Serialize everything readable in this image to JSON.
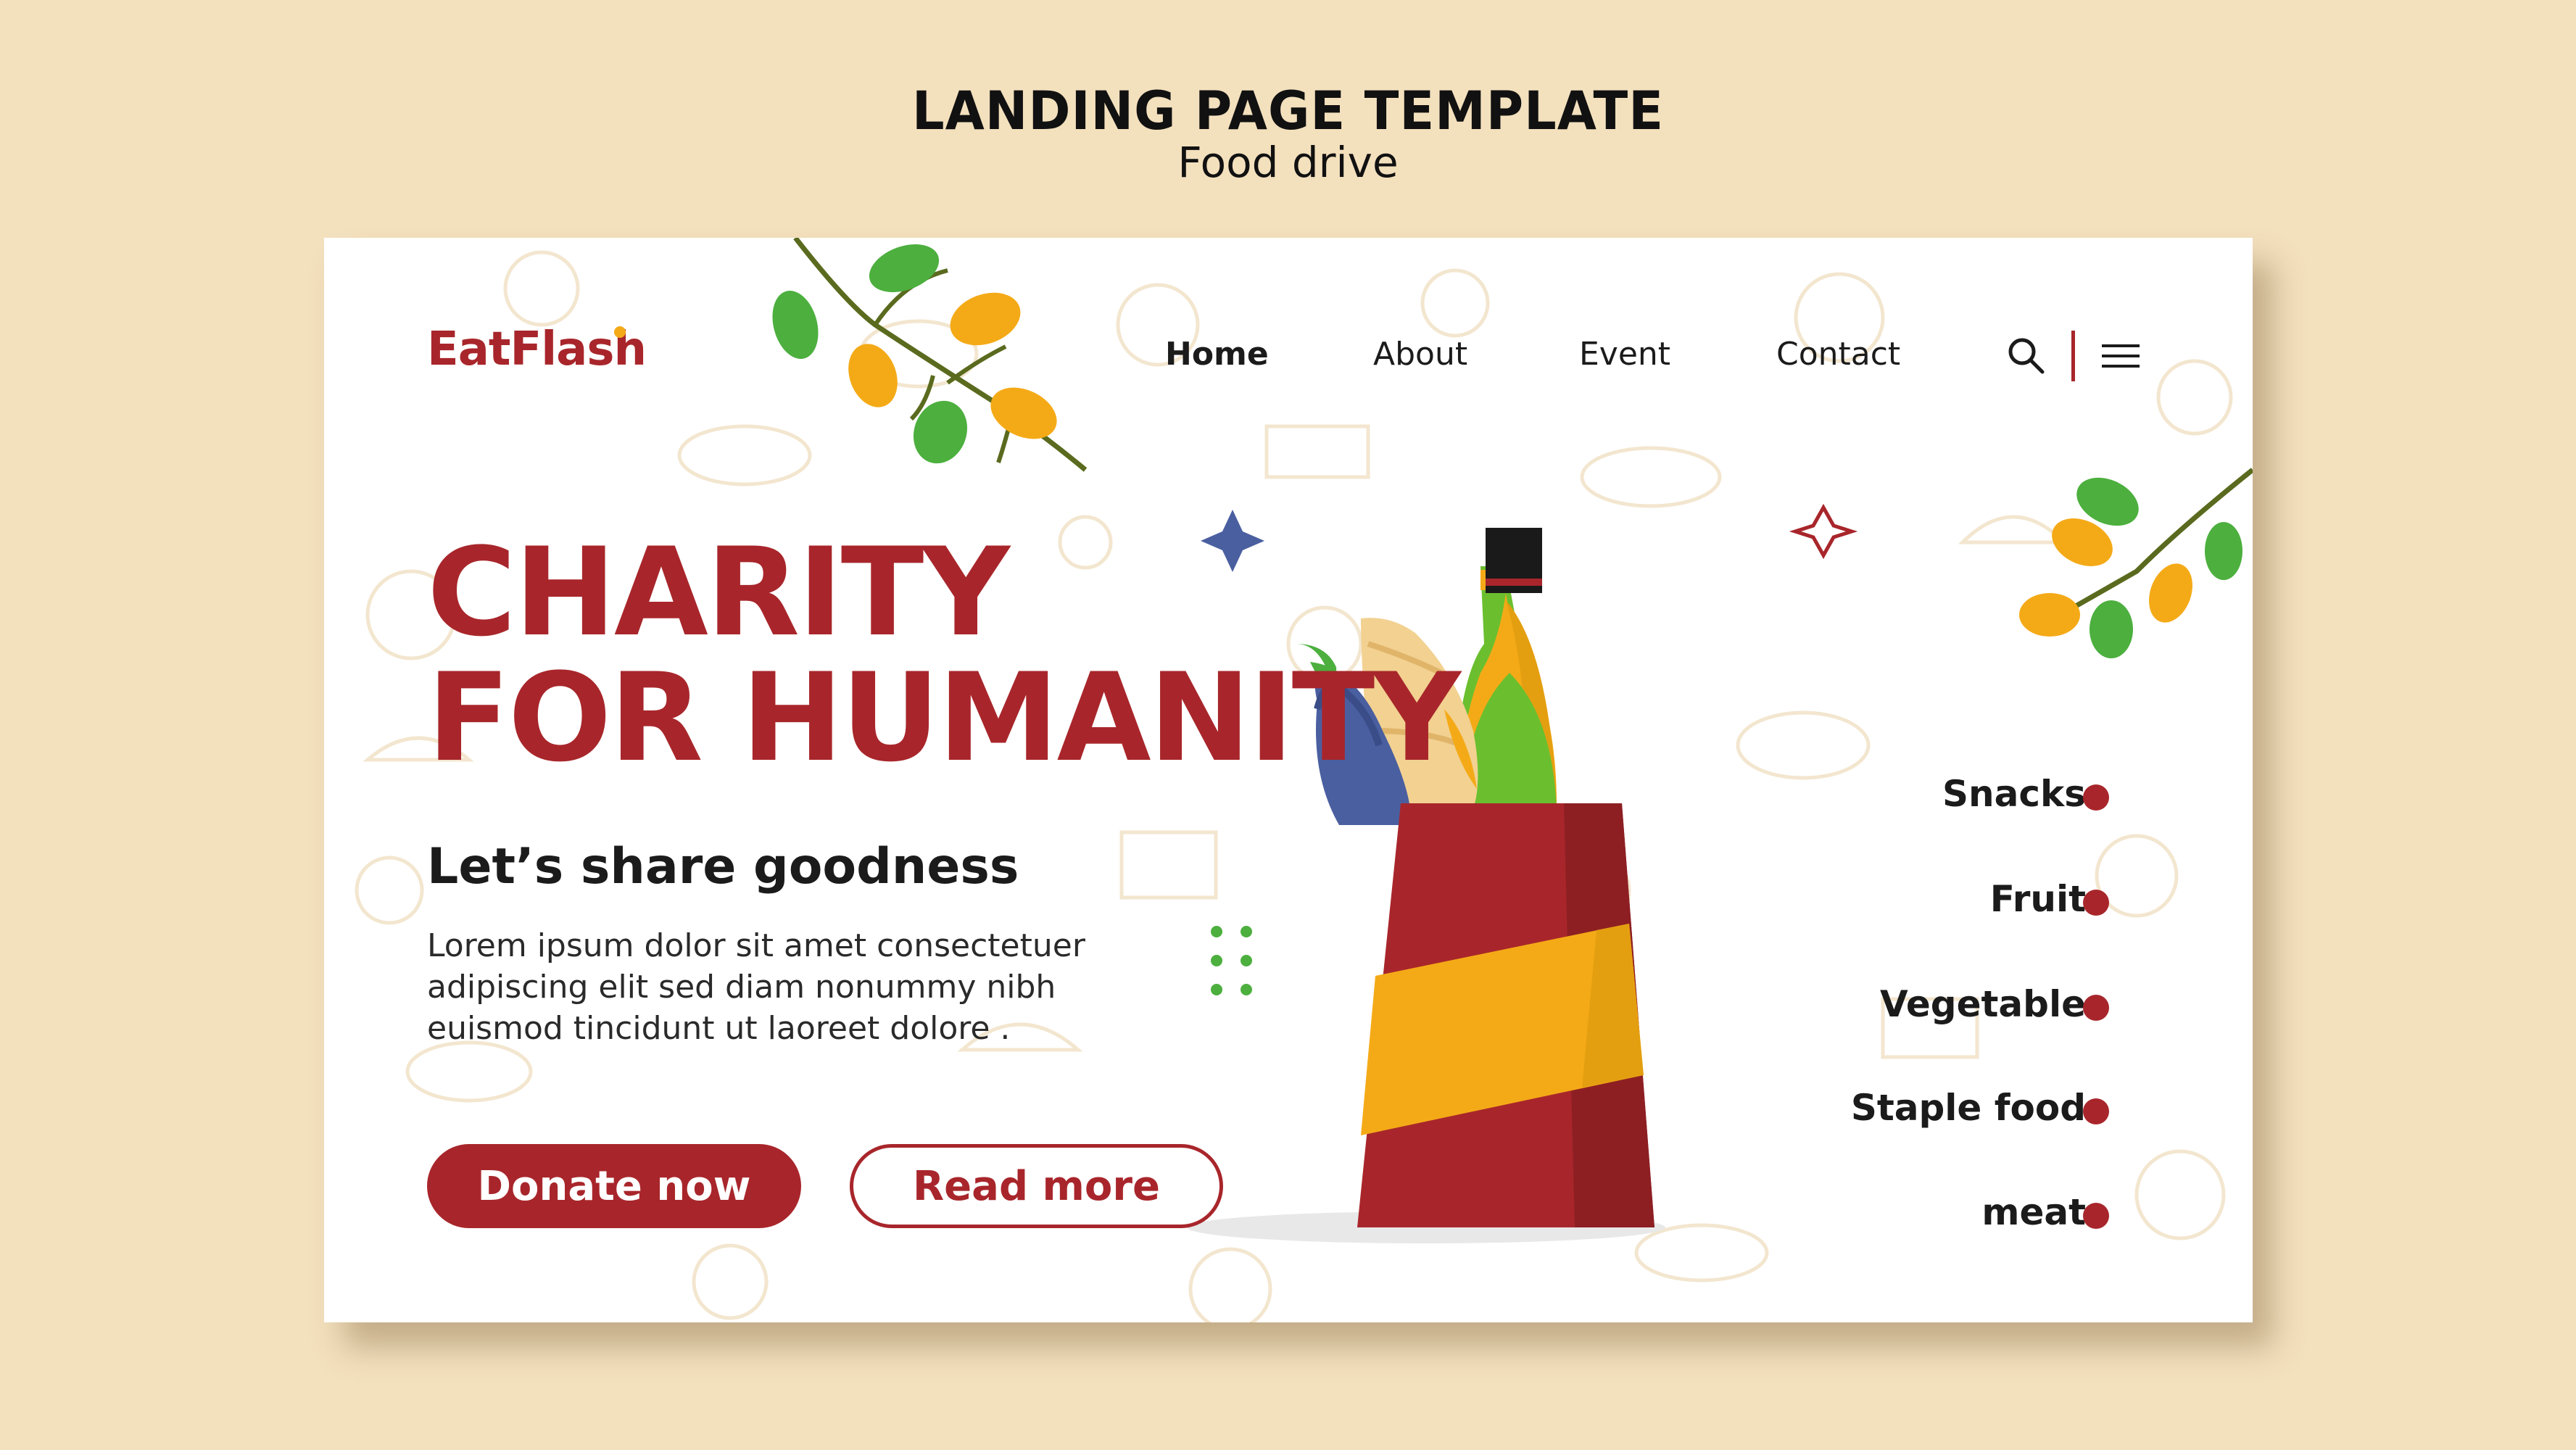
{
  "header": {
    "title": "LANDING PAGE TEMPLATE",
    "subtitle": "Food drive"
  },
  "brand": {
    "logo": "EatFlash",
    "primary_color": "#a8262b",
    "accent_color": "#f4aa17",
    "page_background": "#f3e0bd"
  },
  "nav": {
    "items": [
      {
        "label": "Home",
        "active": true
      },
      {
        "label": "About",
        "active": false
      },
      {
        "label": "Event",
        "active": false
      },
      {
        "label": "Contact",
        "active": false
      }
    ],
    "icons": [
      "search-icon",
      "menu-icon"
    ]
  },
  "hero": {
    "title_line1": "CHARITY",
    "title_line2": "FOR HUMANITY",
    "subtitle": "Let’s share goodness",
    "body": "Lorem ipsum dolor sit amet consectetuer adipiscing elit sed diam nonummy nibh euismod tincidunt ut laoreet dolore ."
  },
  "buttons": {
    "donate": "Donate now",
    "read_more": "Read more"
  },
  "categories": [
    "Snacks",
    "Fruit",
    "Vegetable",
    "Staple food",
    "meat"
  ],
  "illustration": {
    "subject": "grocery bag with eggplant, bread and bottle",
    "colors": {
      "bag_red": "#a8262b",
      "band_yellow": "#f4aa17",
      "leaf_green": "#4caf3e",
      "eggplant": "#4a5fa0"
    }
  }
}
